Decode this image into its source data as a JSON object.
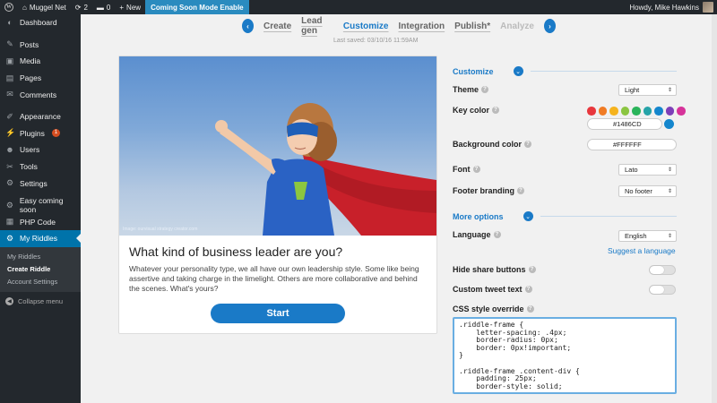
{
  "adminbar": {
    "site_name": "Muggel Net",
    "updates_count": "2",
    "comments_count": "0",
    "new_label": "New",
    "coming_soon_label": "Coming Soon Mode Enable",
    "howdy": "Howdy, Mike Hawkins"
  },
  "sidebar": {
    "items": [
      {
        "label": "Dashboard",
        "icon": "dashboard-icon",
        "glyph": "◐"
      },
      {
        "label": "Posts",
        "icon": "pin-icon",
        "glyph": "✎"
      },
      {
        "label": "Media",
        "icon": "media-icon",
        "glyph": "▣"
      },
      {
        "label": "Pages",
        "icon": "pages-icon",
        "glyph": "▤"
      },
      {
        "label": "Comments",
        "icon": "comments-icon",
        "glyph": "✉"
      },
      {
        "label": "Appearance",
        "icon": "brush-icon",
        "glyph": "✐"
      },
      {
        "label": "Plugins",
        "icon": "plugin-icon",
        "glyph": "⚡",
        "badge": "1"
      },
      {
        "label": "Users",
        "icon": "users-icon",
        "glyph": "☻"
      },
      {
        "label": "Tools",
        "icon": "tools-icon",
        "glyph": "✂"
      },
      {
        "label": "Settings",
        "icon": "settings-icon",
        "glyph": "⚙"
      },
      {
        "label": "Easy coming soon",
        "icon": "gear-icon",
        "glyph": "⚙"
      },
      {
        "label": "PHP Code",
        "icon": "code-icon",
        "glyph": "▦"
      },
      {
        "label": "My Riddles",
        "icon": "riddles-icon",
        "glyph": "⚙"
      }
    ],
    "submenu": [
      "My Riddles",
      "Create Riddle",
      "Account Settings"
    ],
    "collapse_label": "Collapse menu"
  },
  "steps": {
    "items": [
      "Create",
      "Lead gen",
      "Customize",
      "Integration",
      "Publish*",
      "Analyze"
    ],
    "current": "Customize",
    "last_saved": "Last saved: 03/10/16 11:59AM"
  },
  "preview": {
    "image_credit": "Image: ourvisual strategy creator.com",
    "title": "What kind of business leader are you?",
    "description": "Whatever your personality type, we all have our own leadership style. Some like being assertive and taking charge in the limelight. Others are more collaborative and behind the scenes. What's yours?",
    "start_label": "Start"
  },
  "settings": {
    "customize_title": "Customize",
    "theme_label": "Theme",
    "theme_value": "Light",
    "key_color_label": "Key color",
    "key_color_value": "#1486CD",
    "swatches": [
      "#e8373d",
      "#f07b24",
      "#f5b31e",
      "#8bc541",
      "#2ab45a",
      "#26a3a8",
      "#1486cd",
      "#7d3fb8",
      "#d6339a"
    ],
    "background_color_label": "Background color",
    "background_color_value": "#FFFFFF",
    "font_label": "Font",
    "font_value": "Lato",
    "footer_label": "Footer branding",
    "footer_value": "No footer",
    "more_options_title": "More options",
    "language_label": "Language",
    "language_value": "English",
    "suggest_language": "Suggest a language",
    "hide_share_label": "Hide share buttons",
    "custom_tweet_label": "Custom tweet text",
    "css_override_label": "CSS style override",
    "css_value": ".riddle-frame {\n    letter-spacing: .4px;\n    border-radius: 0px;\n    border: 0px!important;\n}\n\n.riddle-frame .content-div {\n    padding: 25px;\n    border-style: solid;"
  },
  "colors": {
    "accent": "#1a7ac7",
    "admin_bar": "#23282d",
    "active_menu": "#0073aa"
  }
}
